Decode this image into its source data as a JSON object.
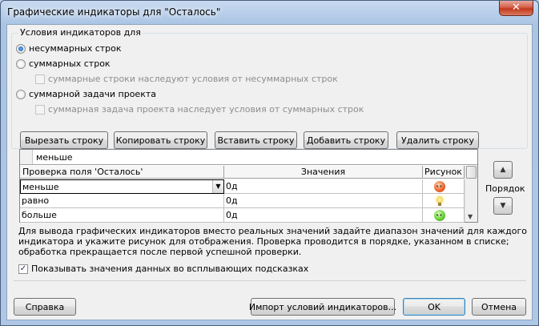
{
  "window": {
    "title": "Графические индикаторы для \"Осталось\"",
    "close_label": "✕"
  },
  "conditions": {
    "legend": "Условия индикаторов для",
    "options": [
      {
        "label": "несуммарных строк",
        "selected": true
      },
      {
        "label": "суммарных строк",
        "selected": false
      },
      {
        "label": "суммарные строки наследуют условия от несуммарных строк",
        "checked": false,
        "disabled": true
      },
      {
        "label": "суммарной задачи проекта",
        "selected": false
      },
      {
        "label": "суммарная задача проекта наследует условия от суммарных строк",
        "checked": false,
        "disabled": true
      }
    ]
  },
  "toolbar": {
    "cut": "Вырезать строку",
    "copy": "Копировать строку",
    "paste": "Вставить строку",
    "add": "Добавить строку",
    "delete": "Удалить строку"
  },
  "grid": {
    "edit_value": "меньше",
    "headers": {
      "test": "Проверка поля 'Осталось'",
      "values": "Значения",
      "image": "Рисунок"
    },
    "rows": [
      {
        "test": "меньше",
        "value": "0д",
        "icon": "red-sad-face-icon"
      },
      {
        "test": "равно",
        "value": "0д",
        "icon": "yellow-lightbulb-icon"
      },
      {
        "test": "больше",
        "value": "0д",
        "icon": "green-smiley-face-icon"
      }
    ]
  },
  "order": {
    "label": "Порядок",
    "up": "▲",
    "down": "▼"
  },
  "description": "Для вывода графических индикаторов вместо реальных значений задайте диапазон значений для каждого индикатора и укажите рисунок для отображения.  Проверка проводится в порядке, указанном в списке; обработка прекращается после первой успешной проверки.",
  "tooltip_option": {
    "label": "Показывать значения данных во всплывающих подсказках",
    "checked": true
  },
  "footer": {
    "help": "Справка",
    "import": "Импорт условий индикаторов...",
    "ok": "OK",
    "cancel": "Отмена"
  }
}
